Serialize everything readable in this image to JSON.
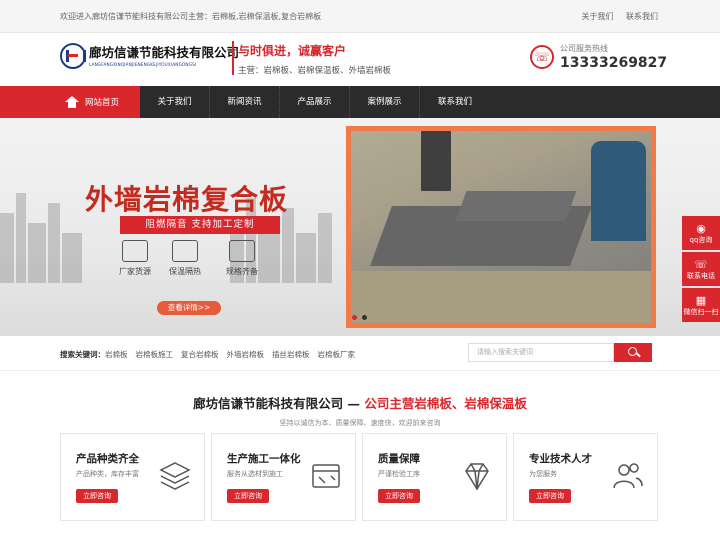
{
  "topbar": {
    "welcome": "欢迎进入廊坊信谦节能科技有限公司主营：岩棉板,岩棉保温板,复合岩棉板",
    "links": [
      "关于我们",
      "联系我们"
    ]
  },
  "header": {
    "logo_cn": "廊坊信谦节能科技有限公司",
    "logo_en": "LANGFANGXINQIANJIENENGKEJIYOUXIANGONGSI",
    "slogan": "与时俱进，诚赢客户",
    "business": "主营：岩棉板、岩棉保温板、外墙岩棉板",
    "hotline_label": "公司服务热线",
    "hotline_number": "13333269827"
  },
  "nav": {
    "home": "网站首页",
    "items": [
      "关于我们",
      "新闻资讯",
      "产品展示",
      "案例展示",
      "联系我们"
    ]
  },
  "banner": {
    "title": "外墙岩棉复合板",
    "subtitle": "阻燃隔音 支持加工定制",
    "features": [
      "厂家货源",
      "保温隔热",
      "规格齐备"
    ],
    "detail_button": "查看详情>>"
  },
  "side_tools": [
    "qq咨询",
    "联系电话",
    "微信扫一扫"
  ],
  "search": {
    "label": "搜索关键词：",
    "keywords": [
      "岩棉板",
      "岩棉板施工",
      "复合岩棉板",
      "外墙岩棉板",
      "插丝岩棉板",
      "岩棉板厂家"
    ],
    "placeholder": "请输入搜索关键词"
  },
  "intro": {
    "company": "廊坊信谦节能科技有限公司 —",
    "highlight": "公司主营岩棉板、岩棉保温板",
    "desc": "坚持以诚信为本、质量保障、速度快，欢迎前来咨询"
  },
  "cards": [
    {
      "title": "产品种类齐全",
      "desc": "产品种类，库存丰富",
      "button": "立即咨询",
      "icon": "layers-icon"
    },
    {
      "title": "生产施工一体化",
      "desc": "服务从选材到施工",
      "button": "立即咨询",
      "icon": "toolbox-icon"
    },
    {
      "title": "质量保障",
      "desc": "严谨检验工序",
      "button": "立即咨询",
      "icon": "diamond-icon"
    },
    {
      "title": "专业技术人才",
      "desc": "为您服务",
      "button": "立即咨询",
      "icon": "team-icon"
    }
  ],
  "colors": {
    "brand_red": "#d9272e",
    "nav_dark": "#2b2b2b"
  }
}
